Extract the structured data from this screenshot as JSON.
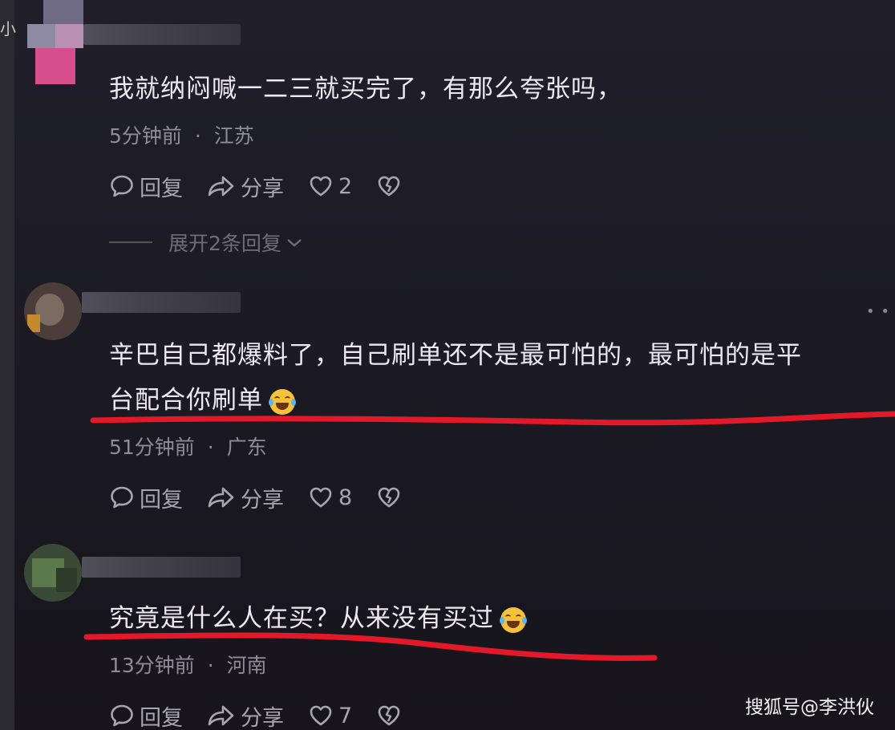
{
  "comments": [
    {
      "text": "我就纳闷喊一二三就买完了，有那么夸张吗，",
      "time": "5分钟前",
      "location": "江苏",
      "reply_label": "回复",
      "share_label": "分享",
      "likes": "2",
      "expand_label": "展开2条回复"
    },
    {
      "text_line1": "辛巴自己都爆料了，自己刷单还不是最可怕的，最可怕的是平",
      "text_line2": "台配合你刷单",
      "time": "51分钟前",
      "location": "广东",
      "reply_label": "回复",
      "share_label": "分享",
      "likes": "8"
    },
    {
      "text": "究竟是什么人在买？从来没有买过",
      "time": "13分钟前",
      "location": "河南",
      "reply_label": "回复",
      "share_label": "分享",
      "likes": "7"
    }
  ],
  "separator": "·",
  "side_glyph": "小",
  "watermark": "搜狐号@李洪伙",
  "colors": {
    "background": "#1c1b22",
    "text": "#eceaf0",
    "meta": "#8e8c95",
    "underline": "#e3192a",
    "emoji": "#f6c23a"
  },
  "icons": [
    "comment-icon",
    "share-icon",
    "heart-icon",
    "broken-heart-icon",
    "chevron-down-icon",
    "more-icon",
    "laughing-crying-emoji"
  ]
}
